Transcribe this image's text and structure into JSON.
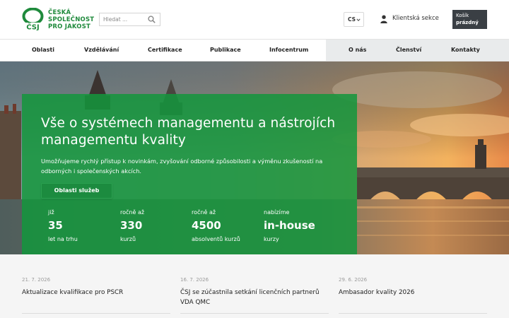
{
  "header": {
    "logo_lines": [
      "ČESKÁ",
      "SPOLEČNOST",
      "PRO JAKOST"
    ],
    "logo_mark_text": "ČSJ",
    "search_placeholder": "Hledat ...",
    "language": "CS",
    "client_section": "Klientská sekce",
    "cart_label": "Košík",
    "cart_status": "prázdný"
  },
  "nav": {
    "items": [
      "Oblasti",
      "Vzdělávání",
      "Certifikace",
      "Publikace",
      "Infocentrum",
      "O nás",
      "Členství",
      "Kontakty"
    ]
  },
  "hero": {
    "title": "Vše o systémech managementu a nástrojích managementu kvality",
    "description": "Umožňujeme rychlý přístup k novinkám, zvyšování odborné způsobilosti a výměnu zkušeností na odborných i společenských akcích.",
    "button": "Oblasti služeb",
    "stats": [
      {
        "pre": "již",
        "value": "35",
        "post": "let na trhu"
      },
      {
        "pre": "ročně až",
        "value": "330",
        "post": "kurzů"
      },
      {
        "pre": "ročně až",
        "value": "4500",
        "post": "absolventů kurzů"
      },
      {
        "pre": "nabízíme",
        "value": "in-house",
        "post": "kurzy"
      }
    ]
  },
  "news": [
    {
      "date": "21. 7. 2026",
      "title": "Aktualizace kvalifikace pro PSCR"
    },
    {
      "date": "16. 7. 2026",
      "title": "ČSJ se zúčastnila setkání licenčních partnerů VDA QMC"
    },
    {
      "date": "29. 6. 2026",
      "title": "Ambasador kvality 2026"
    }
  ],
  "colors": {
    "brand_green": "#1f8a3c",
    "panel_green": "#14963c",
    "cart_bg": "#3a3f44"
  },
  "icons": [
    "search-icon",
    "chevron-down-icon",
    "user-icon"
  ]
}
